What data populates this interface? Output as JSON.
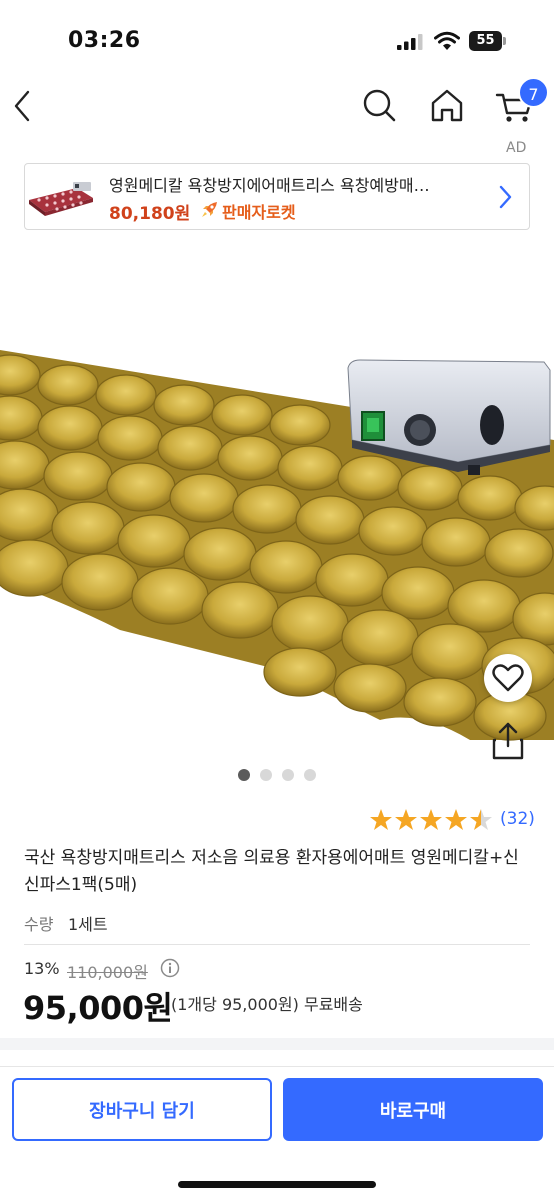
{
  "status_bar": {
    "time": "03:26",
    "battery": "55"
  },
  "nav": {
    "cart_count": "7",
    "ad_tag": "AD"
  },
  "ad_banner": {
    "title": "영원메디칼 욕창방지에어매트리스 욕창예방매…",
    "price": "80,180원",
    "badge": "판매자로켓"
  },
  "gallery": {
    "total_images": 4,
    "active_index": 0
  },
  "rating": {
    "stars": 4.5,
    "max": 5,
    "review_count": "(32)"
  },
  "product": {
    "title": "국산 욕창방지매트리스 저소음 의료용 환자용에어매트 영원메디칼+신신파스1팩(5매)",
    "quantity_label": "수량",
    "quantity_value": "1세트"
  },
  "price": {
    "discount_rate": "13%",
    "original": "110,000원",
    "sale": "95,000원",
    "unit_info": "(1개당 95,000원) 무료배송"
  },
  "actions": {
    "add_to_cart": "장바구니 담기",
    "buy_now": "바로구매"
  },
  "colors": {
    "accent": "#346aff",
    "ad_price": "#d0421b",
    "rocket": "#e55d1a",
    "star": "#f5a623"
  }
}
